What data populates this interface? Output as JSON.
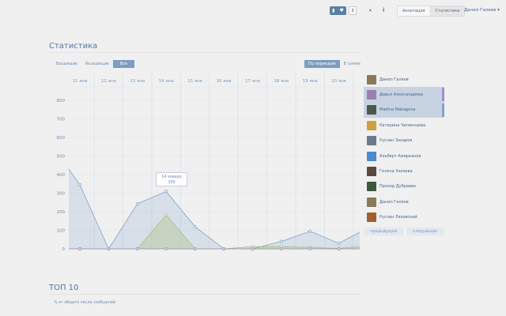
{
  "topbar": {
    "badge_icons": [
      "bookmark-icon",
      "heart-icon"
    ],
    "count": "3",
    "menu": [
      "Аннотация",
      "Статистика"
    ],
    "active_menu": "Статистика",
    "user": "Данил Галеев ▾"
  },
  "page": {
    "title": "Статистика",
    "filters": [
      "Входящие",
      "Исходящие",
      "Все"
    ],
    "active_filter": "Все",
    "modes": [
      "По периодам",
      "В сумме"
    ],
    "active_mode": "По периодам"
  },
  "tooltip": {
    "date": "14 января",
    "value": "309"
  },
  "chart_data": {
    "type": "area",
    "categories": [
      "11 янв",
      "12 янв",
      "13 янв",
      "14 янв",
      "15 янв",
      "16 янв",
      "17 янв",
      "18 янв",
      "19 янв",
      "20 янв"
    ],
    "ylim": [
      0,
      800
    ],
    "yticks": [
      0,
      100,
      200,
      300,
      400,
      500,
      600,
      700,
      800
    ],
    "grid": true,
    "series": [
      {
        "color": "#7fa3cb",
        "values": [
          345,
          0,
          243,
          309,
          120,
          0,
          0,
          40,
          95,
          30
        ],
        "left_overflow": 430,
        "right_overflow": 90
      },
      {
        "color": "#a8c07a",
        "values": [
          0,
          0,
          0,
          183,
          0,
          0,
          12,
          12,
          8,
          2
        ],
        "left_overflow": 0,
        "right_overflow": 12
      },
      {
        "color": "#a78bd6",
        "values": [
          0,
          0,
          0,
          0,
          0,
          0,
          0,
          0,
          0,
          0
        ],
        "left_overflow": 0,
        "right_overflow": 0
      }
    ]
  },
  "people": [
    {
      "name": "Данил Галеев",
      "selected": false,
      "color": "#8a7a5a"
    },
    {
      "name": "Дарья Александрова",
      "selected": true,
      "color": "#9a7fb0",
      "bar": "#a78bd6"
    },
    {
      "name": "Madina Makagova",
      "selected": true,
      "color": "#4a5a4a",
      "bar": "#7fa3cb"
    },
    {
      "name": "Катерина Чигвинцева",
      "selected": false,
      "color": "#d0a040"
    },
    {
      "name": "Руслан Захаров",
      "selected": false,
      "color": "#6a7a8a"
    },
    {
      "name": "Альберт Амирханов",
      "selected": false,
      "color": "#4a8ad0"
    },
    {
      "name": "Гелена Хазеева",
      "selected": false,
      "color": "#5a4a40"
    },
    {
      "name": "Прохор Дубравин",
      "selected": false,
      "color": "#3a5a3a"
    },
    {
      "name": "Данил Галеев",
      "selected": false,
      "color": "#8a7a5a"
    },
    {
      "name": "Руслан Лазовский",
      "selected": false,
      "color": "#a06030"
    }
  ],
  "pager": {
    "prev": "предыдущие",
    "next": "следующие"
  },
  "top10": {
    "title": "ТОП 10",
    "note": "% от общего числа сообщений"
  }
}
